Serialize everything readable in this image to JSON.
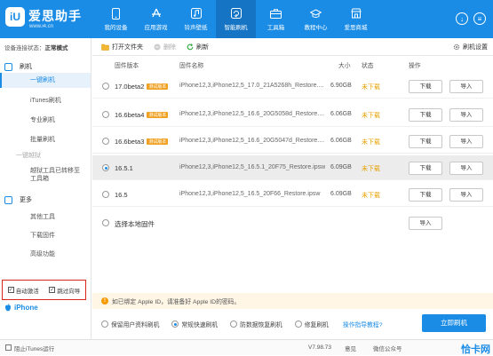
{
  "app": {
    "logo_glyph": "iU",
    "name": "爱思助手",
    "url": "www.i4.cn"
  },
  "nav": [
    {
      "label": "我的设备",
      "icon": "phone-icon"
    },
    {
      "label": "应用游戏",
      "icon": "appstore-icon"
    },
    {
      "label": "铃声壁纸",
      "icon": "music-icon"
    },
    {
      "label": "智能刷机",
      "icon": "flash-icon",
      "active": true
    },
    {
      "label": "工具箱",
      "icon": "toolbox-icon"
    },
    {
      "label": "教程中心",
      "icon": "graduation-icon"
    },
    {
      "label": "爱思商城",
      "icon": "shop-icon"
    }
  ],
  "window": {
    "download_glyph": "↓",
    "menu_glyph": "≡"
  },
  "sidebar": {
    "status_label": "设备连接状态：",
    "status_value": "正常模式",
    "flash_section": "刷机",
    "items": [
      "一键刷机",
      "iTunes刷机",
      "专业刷机",
      "批量刷机"
    ],
    "jailbreak_section": "一键越狱",
    "jailbreak_note": "越狱工具已转移至工具箱",
    "more_section": "更多",
    "more_items": [
      "其他工具",
      "下载固件",
      "高级功能"
    ],
    "opt_auto_activate": "自动激活",
    "opt_skip_setup": "跳过向导",
    "device_name": "iPhone"
  },
  "toolbar": {
    "open_folder": "打开文件夹",
    "delete": "删除",
    "refresh": "刷新",
    "settings": "刷机设置"
  },
  "table": {
    "headers": [
      "固件版本",
      "固件名称",
      "大小",
      "状态",
      "操作"
    ],
    "rows": [
      {
        "version": "17.0beta2",
        "tag": "测试版本",
        "file": "iPhone12,3,iPhone12,5_17.0_21A5268h_Restore....",
        "size": "6.90GB",
        "status": "未下载",
        "dl": "下载",
        "imp": "导入"
      },
      {
        "version": "16.6beta4",
        "tag": "测试版本",
        "file": "iPhone12,3,iPhone12,5_16.6_20G5058d_Restore....",
        "size": "6.06GB",
        "status": "未下载",
        "dl": "下载",
        "imp": "导入"
      },
      {
        "version": "16.6beta3",
        "tag": "测试版本",
        "file": "iPhone12,3,iPhone12,5_16.6_20G5047d_Restore....",
        "size": "6.06GB",
        "status": "未下载",
        "dl": "下载",
        "imp": "导入"
      },
      {
        "version": "16.5.1",
        "tag": "",
        "file": "iPhone12,3,iPhone12,5_16.5.1_20F75_Restore.ipsw",
        "size": "6.09GB",
        "status": "未下载",
        "dl": "下载",
        "imp": "导入",
        "selected": true
      },
      {
        "version": "16.5",
        "tag": "",
        "file": "iPhone12,3,iPhone12,5_16.5_20F66_Restore.ipsw",
        "size": "6.09GB",
        "status": "未下载",
        "dl": "下载",
        "imp": "导入"
      }
    ],
    "local_label": "选择本地固件",
    "local_import": "导入"
  },
  "notice": {
    "glyph": "!",
    "text": "如已绑定 Apple ID，请准备好 Apple ID的密码。"
  },
  "modes": {
    "items": [
      "保留用户资料刷机",
      "常规快速刷机",
      "防数据恢复刷机",
      "修复刷机"
    ],
    "selected_index": 1,
    "help_link": "操作指导教程?",
    "flash_button": "立即刷机"
  },
  "statusbar": {
    "itunes_toggle": "阻止iTunes运行",
    "version": "V7.98.73",
    "feedback": "意见",
    "wechat": "微信公众号",
    "watermark": "恰卡网"
  },
  "colors": {
    "accent": "#1a8ce6",
    "warning": "#e8a000",
    "highlight_border": "#d9261c"
  }
}
